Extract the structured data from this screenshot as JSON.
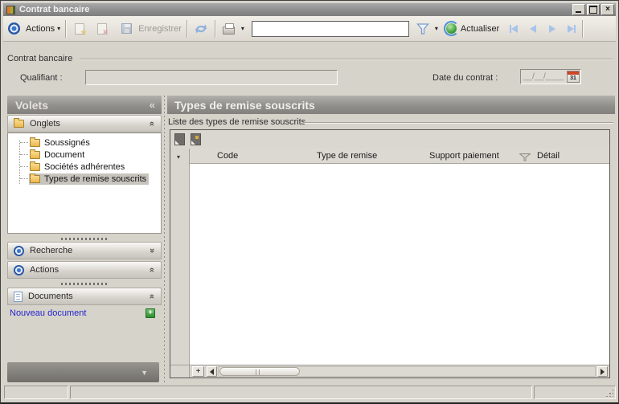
{
  "window": {
    "title": "Contrat bancaire"
  },
  "toolbar": {
    "actions_label": "Actions",
    "save_label": "Enregistrer",
    "refresh_label": "Actualiser",
    "search_value": ""
  },
  "contract": {
    "group_title": "Contrat bancaire",
    "qualifiant_label": "Qualifiant :",
    "qualifiant_value": "",
    "date_label": "Date du contrat :",
    "date_mask": "__/__/____",
    "calendar_day": "31"
  },
  "sidebar": {
    "title": "Volets",
    "sections": {
      "onglets": "Onglets",
      "recherche": "Recherche",
      "actions": "Actions",
      "documents": "Documents"
    },
    "tabs": [
      {
        "label": "Soussignés"
      },
      {
        "label": "Document"
      },
      {
        "label": "Sociétés adhérentes"
      },
      {
        "label": "Types de remise souscrits",
        "selected": true
      }
    ],
    "new_document_label": "Nouveau document"
  },
  "main": {
    "title": "Types de remise souscrits",
    "group_title": "Liste des types de remise souscrits",
    "grid": {
      "columns": [
        "Code",
        "Type de remise",
        "Support paiement",
        "Détail"
      ],
      "rows": []
    }
  },
  "icons": {
    "collapse_left": "«",
    "double_chevron": "»",
    "dropdown_arrow": "▾",
    "row_selector_arrow": "▾",
    "panel_collapse_arrow": "▼",
    "add_plus": "+",
    "close": "×"
  },
  "colors": {
    "accent_blue": "#2a58a6",
    "link_blue": "#2323cd",
    "add_green": "#2e8f2e",
    "calendar_red": "#cf4526"
  }
}
